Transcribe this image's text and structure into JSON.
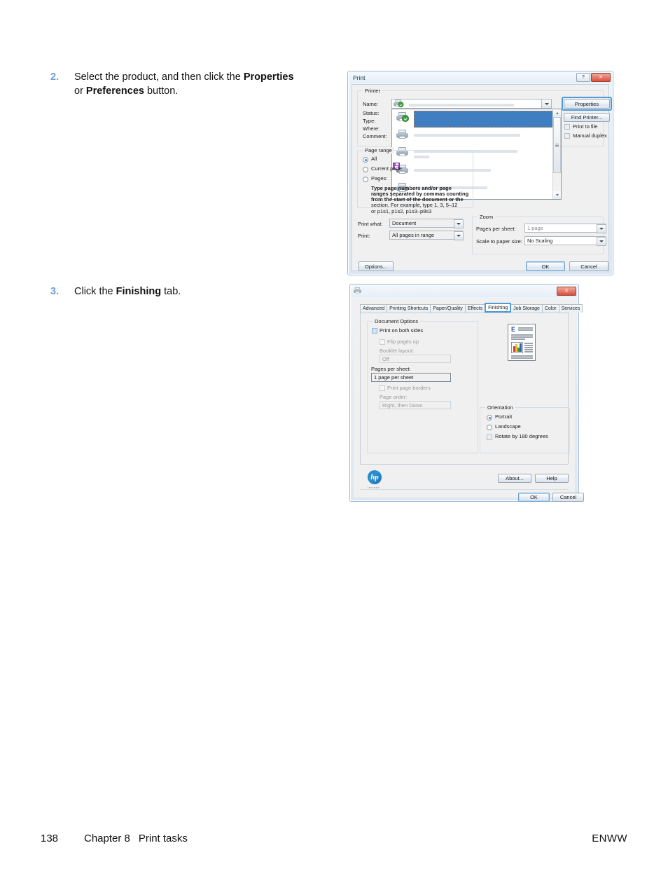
{
  "page": {
    "footer": {
      "page_number": "138",
      "chapter": "Chapter 8",
      "section": "Print tasks",
      "locale": "ENWW"
    },
    "accent_color": "#6d9fd0"
  },
  "steps": [
    {
      "number": "2.",
      "text_part1": "Select the product, and then click the ",
      "bold1": "Properties",
      "text_mid": " or ",
      "bold2": "Preferences",
      "text_end": " button."
    },
    {
      "number": "3.",
      "text_part1": "Click the ",
      "bold1": "Finishing",
      "text_end": " tab."
    }
  ],
  "print_dialog": {
    "title": "Print",
    "help_button": "?",
    "close_button": "✕",
    "printer_group": "Printer",
    "labels": {
      "name": "Name:",
      "status": "Status:",
      "type": "Type:",
      "where": "Where:",
      "comment": "Comment:"
    },
    "buttons": {
      "properties": "Properties",
      "find_printer": "Find Printer...",
      "options": "Options...",
      "ok": "OK",
      "cancel": "Cancel"
    },
    "checkboxes": {
      "print_to_file": "Print to file",
      "manual_duplex": "Manual duplex"
    },
    "page_range": {
      "group": "Page range",
      "all": "All",
      "current": "Current page",
      "pages": "Pages:",
      "hint_line1": "Type page numbers and/or page",
      "hint_line2": "ranges separated by commas counting",
      "hint_line3": "from the start of the document or the",
      "hint_line4": "section. For example, type 1, 3, 5–12",
      "hint_line5": "or p1s1, p1s2, p1s3–p8s3"
    },
    "print_what_label": "Print what:",
    "print_what_value": "Document",
    "print_label": "Print:",
    "print_value": "All pages in range",
    "zoom_group": "Zoom",
    "pages_per_sheet_label": "Pages per sheet:",
    "pages_per_sheet_value": "1 page",
    "scale_label": "Scale to paper size:",
    "scale_value": "No Scaling"
  },
  "finishing_dialog": {
    "title": "",
    "close_button": "✕",
    "tabs": [
      {
        "label": "Advanced",
        "active": false
      },
      {
        "label": "Printing Shortcuts",
        "active": false
      },
      {
        "label": "Paper/Quality",
        "active": false
      },
      {
        "label": "Effects",
        "active": false
      },
      {
        "label": "Finishing",
        "active": true
      },
      {
        "label": "Job Storage",
        "active": false
      },
      {
        "label": "Color",
        "active": false
      },
      {
        "label": "Services",
        "active": false
      }
    ],
    "document_options": {
      "group": "Document Options",
      "print_both_sides": "Print on both sides",
      "flip_pages_up": "Flip pages up",
      "booklet_layout_label": "Booklet layout:",
      "booklet_layout_value": "Off",
      "pages_per_sheet_label": "Pages per sheet:",
      "pages_per_sheet_value": "1 page per sheet",
      "print_page_borders": "Print page borders",
      "page_order_label": "Page order:",
      "page_order_value": "Right, then Down"
    },
    "orientation": {
      "group": "Orientation",
      "portrait": "Portrait",
      "landscape": "Landscape",
      "rotate_180": "Rotate by 180 degrees"
    },
    "preview_letter": "E",
    "logo": {
      "mark": "hp",
      "tagline": "invent"
    },
    "buttons": {
      "about": "About...",
      "help": "Help",
      "ok": "OK",
      "cancel": "Cancel"
    }
  }
}
